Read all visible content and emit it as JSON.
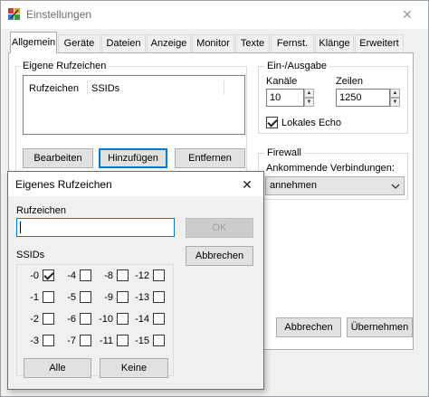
{
  "window": {
    "title": "Einstellungen",
    "close": "✕"
  },
  "tabs": [
    "Allgemein",
    "Geräte",
    "Dateien",
    "Anzeige",
    "Monitor",
    "Texte",
    "Fernst.",
    "Klänge",
    "Erweitert"
  ],
  "callsign_group": {
    "label": "Eigene Rufzeichen",
    "columns": [
      "Rufzeichen",
      "SSIDs"
    ],
    "buttons": {
      "edit": "Bearbeiten",
      "add": "Hinzufügen",
      "remove": "Entfernen"
    }
  },
  "io_group": {
    "label": "Ein-/Ausgabe",
    "channels_label": "Kanäle",
    "channels_value": "10",
    "lines_label": "Zeilen",
    "lines_value": "1250",
    "local_echo_label": "Lokales Echo",
    "local_echo_checked": true
  },
  "firewall_group": {
    "label": "Firewall",
    "incoming_label": "Ankommende Verbindungen:",
    "incoming_value": "annehmen"
  },
  "main_buttons": {
    "cancel": "Abbrechen",
    "apply": "Übernehmen"
  },
  "dialog": {
    "title": "Eigenes Rufzeichen",
    "close": "✕",
    "callsign_label": "Rufzeichen",
    "callsign_value": "",
    "ok": "OK",
    "cancel": "Abbrechen",
    "ssids_label": "SSIDs",
    "ssids": [
      [
        "-0",
        "-4",
        "-8",
        "-12"
      ],
      [
        "-1",
        "-5",
        "-9",
        "-13"
      ],
      [
        "-2",
        "-6",
        "-10",
        "-14"
      ],
      [
        "-3",
        "-7",
        "-11",
        "-15"
      ]
    ],
    "ssid_checked": [
      "-0"
    ],
    "all": "Alle",
    "none": "Keine"
  },
  "colors": {
    "accent": "#0078d7",
    "window_bg": "#f0f0f0",
    "panel_bg": "#ffffff"
  }
}
